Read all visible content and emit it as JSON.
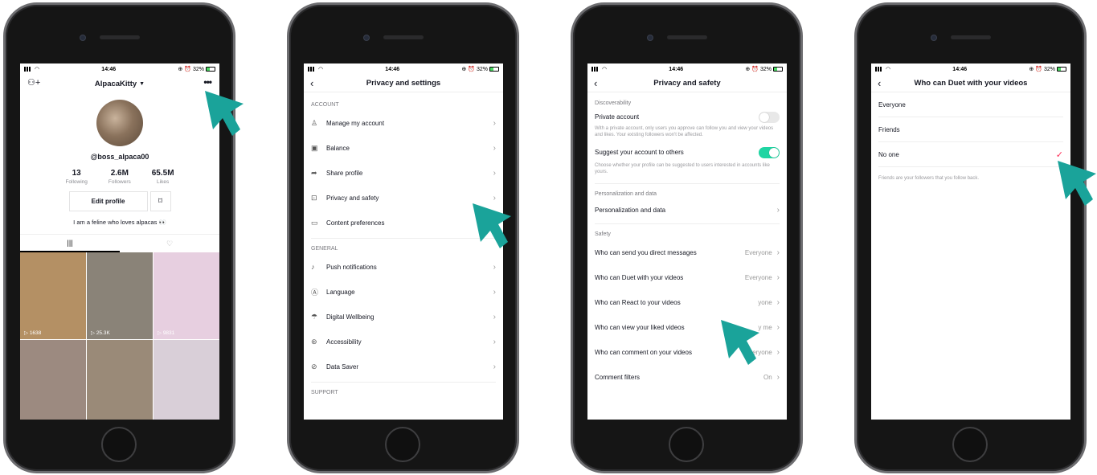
{
  "accent_color": "#1aa39a",
  "status": {
    "time": "14:46",
    "battery": "32%"
  },
  "phone1": {
    "username": "AlpacaKitty",
    "handle": "@boss_alpaca00",
    "stats": [
      {
        "num": "13",
        "cap": "Following"
      },
      {
        "num": "2.6M",
        "cap": "Followers"
      },
      {
        "num": "65.5M",
        "cap": "Likes"
      }
    ],
    "edit_label": "Edit profile",
    "bio": "I am a feline who loves alpacas 👀",
    "videos": [
      {
        "views": "1638",
        "color": "#b49064"
      },
      {
        "views": "25.3K",
        "color": "#8a8378"
      },
      {
        "views": "9831",
        "color": "#e7cfe0"
      },
      {
        "views": "",
        "color": "#9c8a80"
      },
      {
        "views": "",
        "color": "#9a8a78"
      },
      {
        "views": "",
        "color": "#d9cfd8"
      }
    ]
  },
  "phone2": {
    "title": "Privacy and settings",
    "sections": [
      {
        "head": "ACCOUNT",
        "items": [
          "Manage my account",
          "Balance",
          "Share profile",
          "Privacy and safety",
          "Content preferences"
        ]
      },
      {
        "head": "GENERAL",
        "items": [
          "Push notifications",
          "Language",
          "Digital Wellbeing",
          "Accessibility",
          "Data Saver"
        ]
      },
      {
        "head": "SUPPORT",
        "items": []
      }
    ]
  },
  "phone3": {
    "title": "Privacy and safety",
    "discoverability_head": "Discoverability",
    "private_label": "Private account",
    "private_desc": "With a private account, only users you approve can follow you and view your videos and likes. Your existing followers won't be affected.",
    "suggest_label": "Suggest your account to others",
    "suggest_desc": "Choose whether your profile can be suggested to users interested in accounts like yours.",
    "personalization_head": "Personalization and data",
    "personalization_item": "Personalization and data",
    "safety_head": "Safety",
    "safety_items": [
      {
        "label": "Who can send you direct messages",
        "value": "Everyone"
      },
      {
        "label": "Who can Duet with your videos",
        "value": "Everyone"
      },
      {
        "label": "Who can React to your videos",
        "value": "yone"
      },
      {
        "label": "Who can view your liked videos",
        "value": "y me"
      },
      {
        "label": "Who can comment on your videos",
        "value": "Everyone"
      },
      {
        "label": "Comment filters",
        "value": "On"
      }
    ]
  },
  "phone4": {
    "title": "Who can Duet with your videos",
    "options": [
      "Everyone",
      "Friends",
      "No one"
    ],
    "selected": "No one",
    "note": "Friends are your followers that you follow back."
  }
}
